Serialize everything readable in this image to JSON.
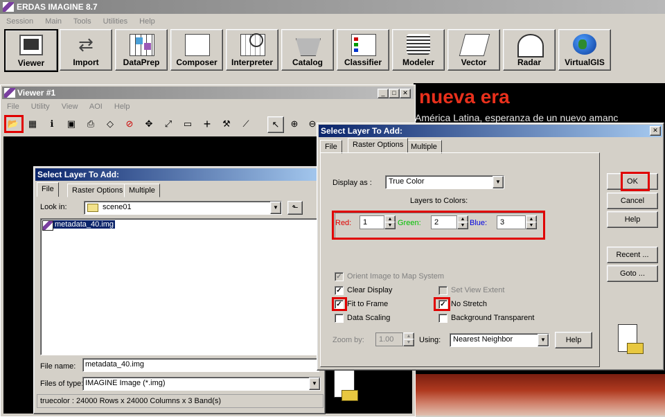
{
  "app": {
    "title": "ERDAS IMAGINE 8.7",
    "menu": [
      "Session",
      "Main",
      "Tools",
      "Utilities",
      "Help"
    ],
    "toolbar": [
      "Viewer",
      "Import",
      "DataPrep",
      "Composer",
      "Interpreter",
      "Catalog",
      "Classifier",
      "Modeler",
      "Vector",
      "Radar",
      "VirtualGIS"
    ]
  },
  "viewer": {
    "title": "Viewer #1",
    "menu": [
      "File",
      "Utility",
      "View",
      "AOI",
      "Help"
    ],
    "tools": [
      "open-icon",
      "raster-icon",
      "info-icon",
      "save-icon",
      "print-icon",
      "eraser-icon",
      "clear-icon",
      "fit-icon",
      "zoom-to-icon",
      "ruler-icon",
      "crosshair-icon",
      "hammer-icon",
      "profile-icon",
      "pointer-icon",
      "zoom-in-icon",
      "zoom-out-icon",
      "pan-icon"
    ]
  },
  "bg_image": {
    "headline": "nueva era",
    "subhead": "América Latina, esperanza de un nuevo amanc"
  },
  "file_dialog": {
    "title": "Select Layer To Add:",
    "tabs": [
      "File",
      "Raster Options",
      "Multiple"
    ],
    "look_in_label": "Look in:",
    "look_in_value": "scene01",
    "file_item": "metadata_40.img",
    "file_name_label": "File name:",
    "file_name_value": "metadata_40.img",
    "file_type_label": "Files of type:",
    "file_type_value": "IMAGINE Image (*.img)",
    "status": "truecolor : 24000 Rows x 24000 Columns x 3 Band(s)"
  },
  "raster_dialog": {
    "title": "Select Layer To Add:",
    "tabs": [
      "File",
      "Raster Options",
      "Multiple"
    ],
    "display_as_label": "Display as :",
    "display_as_value": "True Color",
    "layers_to_colors": "Layers to Colors:",
    "red_label": "Red:",
    "red_value": "1",
    "green_label": "Green:",
    "green_value": "2",
    "blue_label": "Blue:",
    "blue_value": "3",
    "orient": "Orient Image to Map System",
    "clear_display": "Clear Display",
    "set_view_extent": "Set View Extent",
    "fit_to_frame": "Fit to Frame",
    "no_stretch": "No Stretch",
    "data_scaling": "Data Scaling",
    "background_transparent": "Background Transparent",
    "zoom_by_label": "Zoom by:",
    "zoom_by_value": "1.00",
    "using_label": "Using:",
    "using_value": "Nearest Neighbor",
    "help_inline": "Help",
    "buttons": {
      "ok": "OK",
      "cancel": "Cancel",
      "help": "Help",
      "recent": "Recent ...",
      "goto": "Goto ..."
    },
    "colors": {
      "red": "#e00000",
      "green": "#00c000",
      "blue": "#0000e0"
    }
  }
}
